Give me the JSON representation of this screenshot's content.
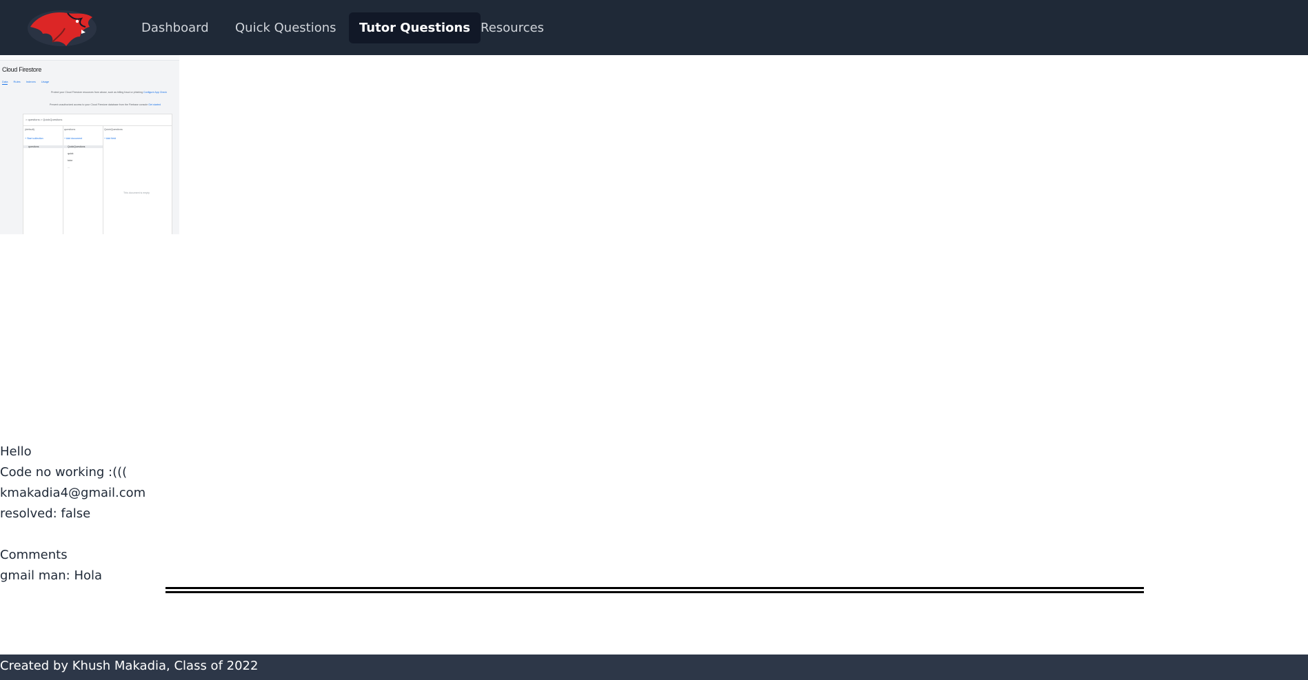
{
  "nav": {
    "items": [
      {
        "label": "Dashboard",
        "active": false
      },
      {
        "label": "Quick Questions",
        "active": false
      },
      {
        "label": "Tutor Questions",
        "active": true
      },
      {
        "label": "Resources",
        "active": false
      }
    ]
  },
  "attachment": {
    "title": "Cloud Firestore",
    "tabs": [
      "Data",
      "Rules",
      "Indexes",
      "Usage"
    ],
    "banner_1": "Protect your Cloud Firestore resources from abuse, such as billing fraud or phishing",
    "banner_1_link": "Configure App Check",
    "banner_2": "Prevent unauthorized access to your Cloud Firestore database from the Firebase console",
    "banner_2_link": "Get started",
    "path": "> questions > QuickQuestions",
    "col1_head": "(default)",
    "col2_head": "questions",
    "col3_head": "QuickQuestions",
    "add_collection": "+ Start collection",
    "add_document": "+ Add document",
    "add_field": "+ Add field",
    "col2_rows": [
      "quick",
      "tutor",
      "..."
    ],
    "col3_row": "QuickQuestions",
    "empty_note": "This document is empty"
  },
  "question": {
    "title": "Hello",
    "body": "Code no working :(((",
    "email": "kmakadia4@gmail.com",
    "resolved": "resolved: false"
  },
  "comments": {
    "heading": "Comments",
    "items": [
      {
        "text": "gmail man: Hola"
      }
    ]
  },
  "footer": {
    "text": "Created by Khush Makadia, Class of 2022"
  },
  "colors": {
    "nav_bg": "#1f2937",
    "nav_active_bg": "#111827",
    "footer_bg": "#2d3748",
    "logo_red": "#dc2626"
  }
}
